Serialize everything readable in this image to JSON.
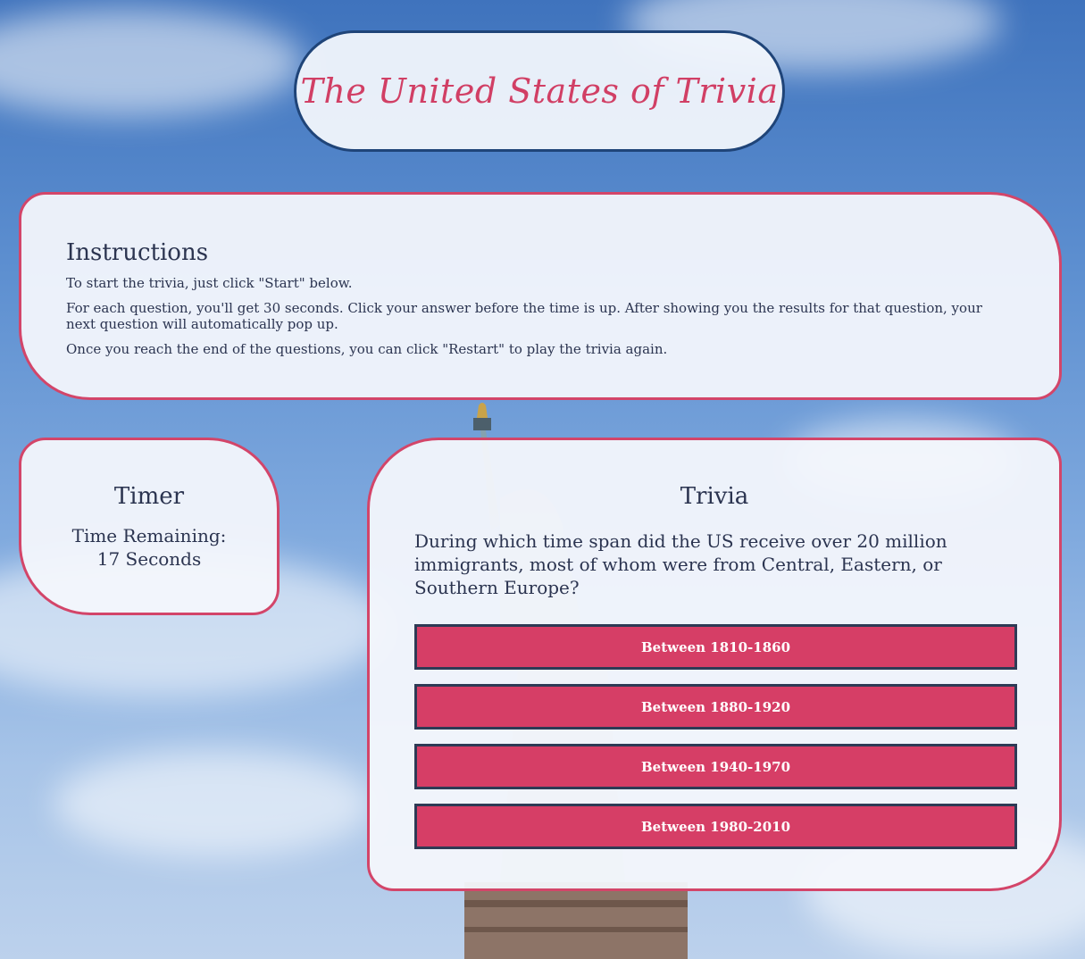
{
  "header": {
    "title": "The United States of Trivia"
  },
  "instructions": {
    "heading": "Instructions",
    "paragraphs": [
      "To start the trivia, just click \"Start\" below.",
      "For each question, you'll get 30 seconds. Click your answer before the time is up. After showing you the results for that question, your next question will automatically pop up.",
      "Once you reach the end of the questions, you can click \"Restart\" to play the trivia again."
    ]
  },
  "timer": {
    "heading": "Timer",
    "label": "Time Remaining:",
    "value": "17 Seconds"
  },
  "trivia": {
    "heading": "Trivia",
    "question": "During which time span did the US receive over 20 million immigrants, most of whom were from Central, Eastern, or Southern Europe?",
    "answers": [
      "Between 1810-1860",
      "Between 1880-1920",
      "Between 1940-1970",
      "Between 1980-2010"
    ]
  },
  "colors": {
    "accent": "#d63e66",
    "title_text": "#d13f65",
    "title_border": "#1f4478",
    "panel_border": "#d34569",
    "text": "#2b3450"
  }
}
